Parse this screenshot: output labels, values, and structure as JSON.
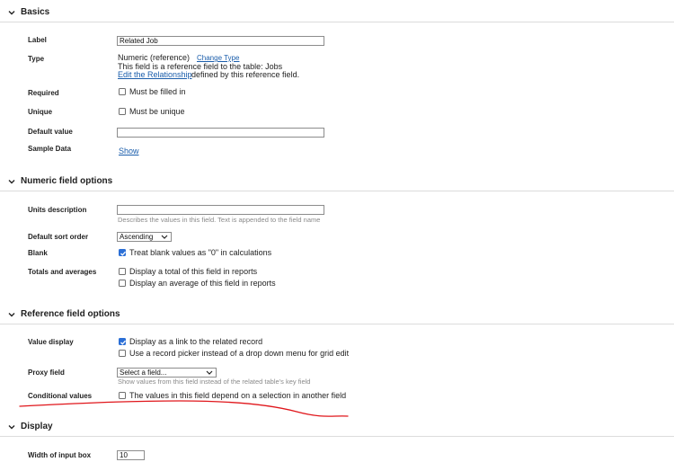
{
  "sections": {
    "basics": {
      "title": "Basics",
      "label_label": "Label",
      "label_value": "Related Job",
      "type_label": "Type",
      "type_value": "Numeric (reference)",
      "change_type_link": "Change Type",
      "type_desc": "This field is a reference field to the table: Jobs",
      "edit_relationship_link": "Edit the Relationship",
      "edit_relationship_suffix": "defined by this reference field.",
      "required_label": "Required",
      "required_option": "Must be filled in",
      "required_checked": false,
      "unique_label": "Unique",
      "unique_option": "Must be unique",
      "unique_checked": false,
      "default_label": "Default value",
      "default_value": "",
      "sample_label": "Sample Data",
      "sample_link": "Show"
    },
    "numeric": {
      "title": "Numeric field options",
      "units_label": "Units description",
      "units_value": "",
      "units_hint": "Describes the values in this field. Text is appended to the field name",
      "sort_label": "Default sort order",
      "sort_value": "Ascending",
      "blank_label": "Blank",
      "blank_option": "Treat blank values as \"0\" in calculations",
      "blank_checked": true,
      "totals_label": "Totals and averages",
      "totals_option1": "Display a total of this field in reports",
      "totals_option1_checked": false,
      "totals_option2": "Display an average of this field in reports",
      "totals_option2_checked": false
    },
    "reference": {
      "title": "Reference field options",
      "value_display_label": "Value display",
      "value_display_option1": "Display as a link to the related record",
      "value_display_option1_checked": true,
      "value_display_option2": "Use a record picker instead of a drop down menu for grid edit",
      "value_display_option2_checked": false,
      "proxy_label": "Proxy field",
      "proxy_value": "Select a field...",
      "proxy_hint": "Show values from this field instead of the related table's key field",
      "conditional_label": "Conditional values",
      "conditional_option": "The values in this field depend on a selection in another field",
      "conditional_checked": false
    },
    "display": {
      "title": "Display",
      "width_label": "Width of input box",
      "width_value": "10"
    }
  },
  "colors": {
    "link": "#1a5dab",
    "checkbox_checked": "#2b6fd6",
    "annotation_red": "#e0161b"
  }
}
